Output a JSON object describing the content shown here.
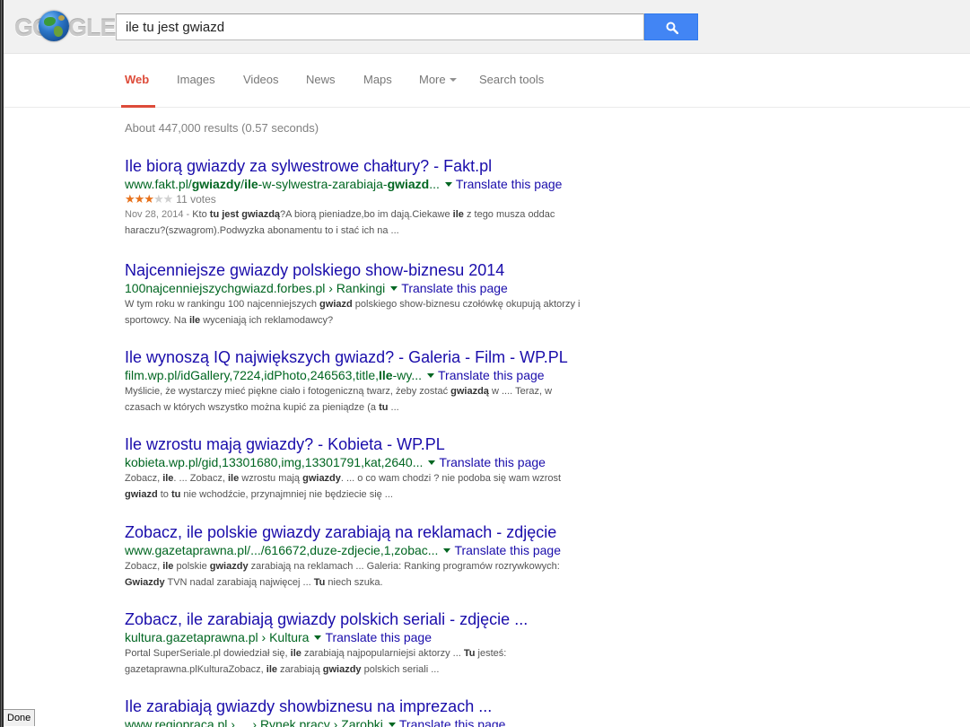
{
  "logo": {
    "text": "GOOGLE"
  },
  "search": {
    "query": "ile tu jest gwiazd"
  },
  "nav": {
    "tabs": [
      "Web",
      "Images",
      "Videos",
      "News",
      "Maps",
      "More",
      "Search tools"
    ]
  },
  "stats": "About 447,000 results (0.57 seconds)",
  "results": [
    {
      "title": "Ile biorą gwiazdy za sylwestrowe chałtury? - Fakt.pl",
      "url_parts": [
        [
          "www.fakt.pl/",
          false
        ],
        [
          "gwiazdy",
          true
        ],
        [
          "/",
          false
        ],
        [
          "ile",
          true
        ],
        [
          "-w-sylwestra-zarabiaja-",
          false
        ],
        [
          "gwiazd",
          true
        ],
        "..."
      ],
      "translate": "Translate this page",
      "rating": {
        "stars_filled": 3,
        "stars_total": 5,
        "votes": "11 votes"
      },
      "snippet": "Nov 28, 2014 - Kto tu jest gwiazdą?A biorą pieniadze,bo im dają.Ciekawe ile z tego musza oddac haraczu?(szwagrom).Podwyzka abonamentu to i stać ich na ..."
    },
    {
      "title": "Najcenniejsze gwiazdy polskiego show-biznesu 2014",
      "url_parts": [
        [
          "100najcenniejszychgwiazd.forbes.pl › Rankingi",
          false
        ]
      ],
      "translate": "Translate this page",
      "snippet": "W tym roku w rankingu 100 najcenniejszych gwiazd polskiego show-biznesu czołówkę okupują aktorzy i sportowcy. Na ile wyceniają ich reklamodawcy?"
    },
    {
      "title": "Ile wynoszą IQ największych gwiazd? - Galeria - Film - WP.PL",
      "url_parts": [
        [
          "film.wp.pl/idGallery,7224,idPhoto,246563,title,",
          false
        ],
        [
          "Ile",
          true
        ],
        [
          "-wy...",
          false
        ]
      ],
      "translate": "Translate this page",
      "snippet": "Myślicie, że wystarczy mieć piękne ciało i fotogeniczną twarz, żeby zostać gwiazdą w .... Teraz, w czasach w których wszystko można kupić za pieniądze (a tu ..."
    },
    {
      "title": "Ile wzrostu mają gwiazdy? - Kobieta - WP.PL",
      "url_parts": [
        [
          "kobieta.wp.pl/gid,13301680,img,13301791,kat,2640...",
          false
        ]
      ],
      "translate": "Translate this page",
      "snippet": "Zobacz, ile. ... Zobacz, ile wzrostu mają gwiazdy. ... o co wam chodzi ? nie podoba się wam wzrost gwiazd to tu nie wchodźcie, przynajmniej nie będziecie się ..."
    },
    {
      "title": "Zobacz, ile polskie gwiazdy zarabiają na reklamach - zdjęcie",
      "url_parts": [
        [
          "www.gazetaprawna.pl/.../616672,duze-zdjecie,1,zobac...",
          false
        ]
      ],
      "translate": "Translate this page",
      "snippet": "Zobacz, ile polskie gwiazdy zarabiają na reklamach ... Galeria: Ranking programów rozrywkowych: Gwiazdy TVN nadal zarabiają najwięcej ... Tu niech szuka."
    },
    {
      "title": "Zobacz, ile zarabiają gwiazdy polskich seriali - zdjęcie ...",
      "url_parts": [
        [
          "kultura.gazetaprawna.pl › Kultura",
          false
        ]
      ],
      "translate": "Translate this page",
      "snippet": "Portal SuperSeriale.pl dowiedział się, ile zarabiają najpopularniejsi aktorzy ... Tu jesteś: gazetaprawna.plKulturaZobacz, ile zarabiają gwiazdy polskich seriali ..."
    },
    {
      "title": "Ile zarabiają gwiazdy showbiznesu na imprezach ...",
      "url_parts": [
        [
          "www.regiopraca.pl › ... › Rynek pracy › Zarobki",
          false
        ]
      ],
      "translate": "Translate this page",
      "snippet": ""
    }
  ],
  "status_bar": "Done",
  "colors": {
    "accent": "#dd4b39",
    "link": "#1a0dab",
    "url": "#006621",
    "search_button": "#4285f4"
  }
}
